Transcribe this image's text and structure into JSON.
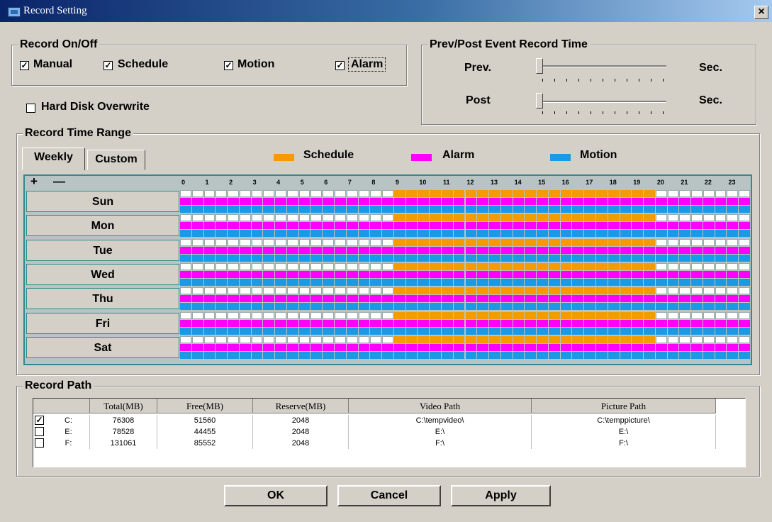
{
  "window": {
    "title": "Record Setting",
    "close_glyph": "×"
  },
  "record_onoff": {
    "title": "Record On/Off",
    "items": [
      {
        "label": "Manual",
        "checked": true
      },
      {
        "label": "Schedule",
        "checked": true
      },
      {
        "label": "Motion",
        "checked": true
      },
      {
        "label": "Alarm",
        "checked": true
      }
    ]
  },
  "hard_disk_overwrite": {
    "label": "Hard Disk Overwrite",
    "checked": false
  },
  "prev_post": {
    "title": "Prev/Post Event Record Time",
    "prev_label": "Prev.",
    "post_label": "Post",
    "unit": "Sec.",
    "prev_level": 0,
    "post_level": 0
  },
  "time_range": {
    "title": "Record Time Range",
    "tabs": [
      "Weekly",
      "Custom"
    ],
    "active_tab": "Weekly",
    "legend": [
      {
        "label": "Schedule",
        "color": "#f59a00"
      },
      {
        "label": "Alarm",
        "color": "#ff00ff"
      },
      {
        "label": "Motion",
        "color": "#1a9ae6"
      }
    ],
    "zoom_in": "+",
    "zoom_out": "—",
    "hours": [
      "0",
      "1",
      "2",
      "3",
      "4",
      "5",
      "6",
      "7",
      "8",
      "9",
      "10",
      "11",
      "12",
      "13",
      "14",
      "15",
      "16",
      "17",
      "18",
      "19",
      "20",
      "21",
      "22",
      "23"
    ],
    "days": [
      "Sun",
      "Mon",
      "Tue",
      "Wed",
      "Thu",
      "Fri",
      "Sat"
    ],
    "schedule_hours": [
      9,
      20
    ],
    "alarm_hours": [
      0,
      24
    ],
    "motion_hours": [
      0,
      24
    ]
  },
  "record_path": {
    "title": "Record Path",
    "columns": [
      "",
      "Total(MB)",
      "Free(MB)",
      "Reserve(MB)",
      "Video Path",
      "Picture Path"
    ],
    "rows": [
      {
        "checked": true,
        "drive": "C:",
        "total": "76308",
        "free": "51560",
        "reserve": "2048",
        "video": "C:\\tempvideo\\",
        "picture": "C:\\temppicture\\"
      },
      {
        "checked": false,
        "drive": "E:",
        "total": "78528",
        "free": "44455",
        "reserve": "2048",
        "video": "E:\\",
        "picture": "E:\\"
      },
      {
        "checked": false,
        "drive": "F:",
        "total": "131061",
        "free": "85552",
        "reserve": "2048",
        "video": "F:\\",
        "picture": "F:\\"
      }
    ]
  },
  "buttons": {
    "ok": "OK",
    "cancel": "Cancel",
    "apply": "Apply"
  }
}
